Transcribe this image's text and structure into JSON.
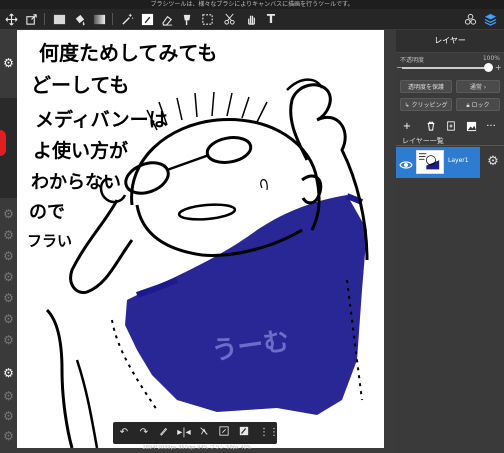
{
  "tip_text": "ブラシツールは、様々なブラシによりキャンバスに描画を行うツールです。",
  "toolbar": {
    "icons": [
      "move-icon",
      "transform-icon",
      "fill-color-icon",
      "bucket-icon",
      "gradient-icon",
      "magic-wand-icon",
      "pen-icon",
      "eraser-icon",
      "smudge-icon",
      "lasso-icon",
      "text-icon",
      "layers-menu-icon",
      "stack-icon"
    ],
    "text_tool_glyph": "T"
  },
  "layer_panel": {
    "title": "レイヤー",
    "opacity_label": "不透明度",
    "opacity_value": "100%",
    "slider_minus": "−",
    "slider_plus": "+",
    "protect_label": "透明度を保護",
    "blend_label": "通常",
    "blend_chevron": "›",
    "clipping_label": "クリッピング",
    "lock_label": "ロック",
    "list_title": "レイヤー一覧",
    "layers": [
      {
        "name": "Layer1",
        "visible": true,
        "selected": true
      }
    ]
  },
  "canvas": {
    "handwriting": [
      "何度ためしてみても",
      "どーしても",
      "メディバンーは",
      "よ使い方が",
      "わからない",
      "ので",
      "フラい"
    ],
    "scribble_text": "うーむ",
    "scribble_color": "#1d1a8f"
  },
  "bottom_bar": {
    "icons": [
      "undo-icon",
      "redo-icon",
      "pen-tip-icon",
      "flip-icon",
      "no-snap-icon",
      "edit-icon",
      "save-icon",
      "grid-icon"
    ]
  },
  "status_text": "2894*2039px 350dpi 94% ブラシ 50px 40%",
  "colors": {
    "accent": "#2e7bd2",
    "panel_bg": "#3a3a3a",
    "toolbar_bg": "#262626"
  }
}
